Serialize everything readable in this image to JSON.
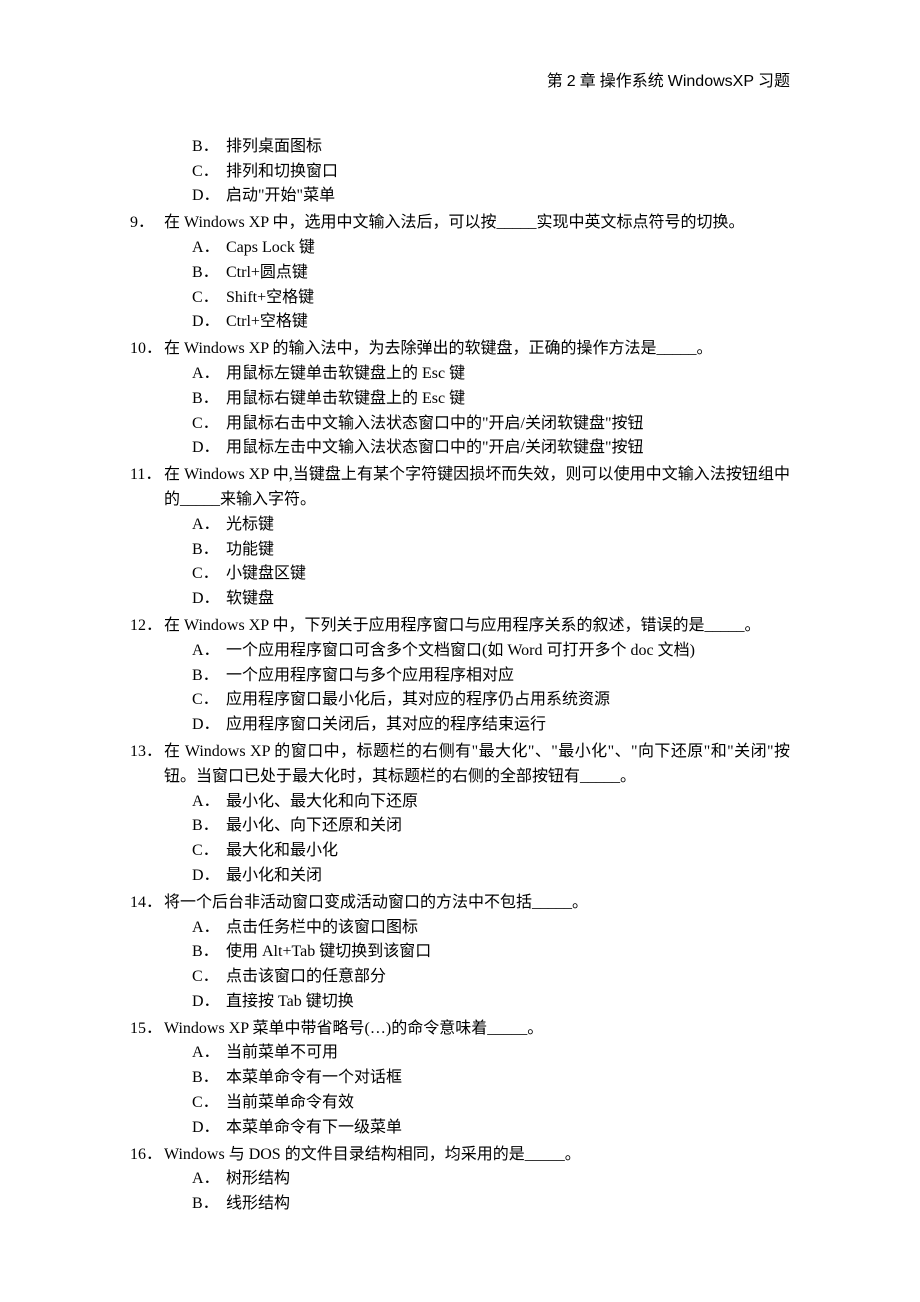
{
  "header": {
    "prefix": "第",
    "num": "2",
    "chapter_word": "章",
    "title_rest": " 操作系统",
    "title_sans": "WindowsXP",
    "suffix": "习题"
  },
  "fragment_options": [
    {
      "letter": "B．",
      "text": "排列桌面图标"
    },
    {
      "letter": "C．",
      "text": "排列和切换窗口"
    },
    {
      "letter": "D．",
      "text": "启动\"开始\"菜单"
    }
  ],
  "questions": [
    {
      "num": "9．",
      "text": "在 Windows XP 中，选用中文输入法后，可以按_____实现中英文标点符号的切换。",
      "options": [
        {
          "letter": "A．",
          "text": "Caps Lock 键"
        },
        {
          "letter": "B．",
          "text": "Ctrl+圆点键"
        },
        {
          "letter": "C．",
          "text": "Shift+空格键"
        },
        {
          "letter": "D．",
          "text": "Ctrl+空格键"
        }
      ]
    },
    {
      "num": "10．",
      "text": "在 Windows XP 的输入法中，为去除弹出的软键盘，正确的操作方法是_____。",
      "options": [
        {
          "letter": "A．",
          "text": "用鼠标左键单击软键盘上的 Esc 键"
        },
        {
          "letter": "B．",
          "text": "用鼠标右键单击软键盘上的 Esc 键"
        },
        {
          "letter": "C．",
          "text": "用鼠标右击中文输入法状态窗口中的\"开启/关闭软键盘\"按钮"
        },
        {
          "letter": "D．",
          "text": "用鼠标左击中文输入法状态窗口中的\"开启/关闭软键盘\"按钮"
        }
      ]
    },
    {
      "num": "11．",
      "text": "在 Windows XP 中,当键盘上有某个字符键因损坏而失效，则可以使用中文输入法按钮组中的_____来输入字符。",
      "options": [
        {
          "letter": "A．",
          "text": "光标键"
        },
        {
          "letter": "B．",
          "text": "功能键"
        },
        {
          "letter": "C．",
          "text": "小键盘区键"
        },
        {
          "letter": "D．",
          "text": "软键盘"
        }
      ]
    },
    {
      "num": "12．",
      "text": "在 Windows XP 中，下列关于应用程序窗口与应用程序关系的叙述，错误的是_____。",
      "options": [
        {
          "letter": "A．",
          "text": "一个应用程序窗口可含多个文档窗口(如 Word 可打开多个 doc 文档)"
        },
        {
          "letter": "B．",
          "text": "一个应用程序窗口与多个应用程序相对应"
        },
        {
          "letter": "C．",
          "text": "应用程序窗口最小化后，其对应的程序仍占用系统资源"
        },
        {
          "letter": "D．",
          "text": "应用程序窗口关闭后，其对应的程序结束运行"
        }
      ]
    },
    {
      "num": "13．",
      "text": "在 Windows XP 的窗口中，标题栏的右侧有\"最大化\"、\"最小化\"、\"向下还原\"和\"关闭\"按钮。当窗口已处于最大化时，其标题栏的右侧的全部按钮有_____。",
      "options": [
        {
          "letter": "A．",
          "text": "最小化、最大化和向下还原"
        },
        {
          "letter": "B．",
          "text": "最小化、向下还原和关闭"
        },
        {
          "letter": "C．",
          "text": "最大化和最小化"
        },
        {
          "letter": "D．",
          "text": "最小化和关闭"
        }
      ]
    },
    {
      "num": "14．",
      "text": "将一个后台非活动窗口变成活动窗口的方法中不包括_____。",
      "options": [
        {
          "letter": "A．",
          "text": "点击任务栏中的该窗口图标"
        },
        {
          "letter": "B．",
          "text": "使用 Alt+Tab 键切换到该窗口"
        },
        {
          "letter": "C．",
          "text": "点击该窗口的任意部分"
        },
        {
          "letter": "D．",
          "text": "直接按 Tab 键切换"
        }
      ]
    },
    {
      "num": "15．",
      "text": "Windows XP 菜单中带省略号(…)的命令意味着_____。",
      "options": [
        {
          "letter": "A．",
          "text": "当前菜单不可用"
        },
        {
          "letter": "B．",
          "text": "本菜单命令有一个对话框"
        },
        {
          "letter": "C．",
          "text": "当前菜单命令有效"
        },
        {
          "letter": "D．",
          "text": "本菜单命令有下一级菜单"
        }
      ]
    },
    {
      "num": "16．",
      "text": "Windows 与 DOS 的文件目录结构相同，均采用的是_____。",
      "options": [
        {
          "letter": "A．",
          "text": "树形结构"
        },
        {
          "letter": "B．",
          "text": "线形结构"
        }
      ]
    }
  ]
}
